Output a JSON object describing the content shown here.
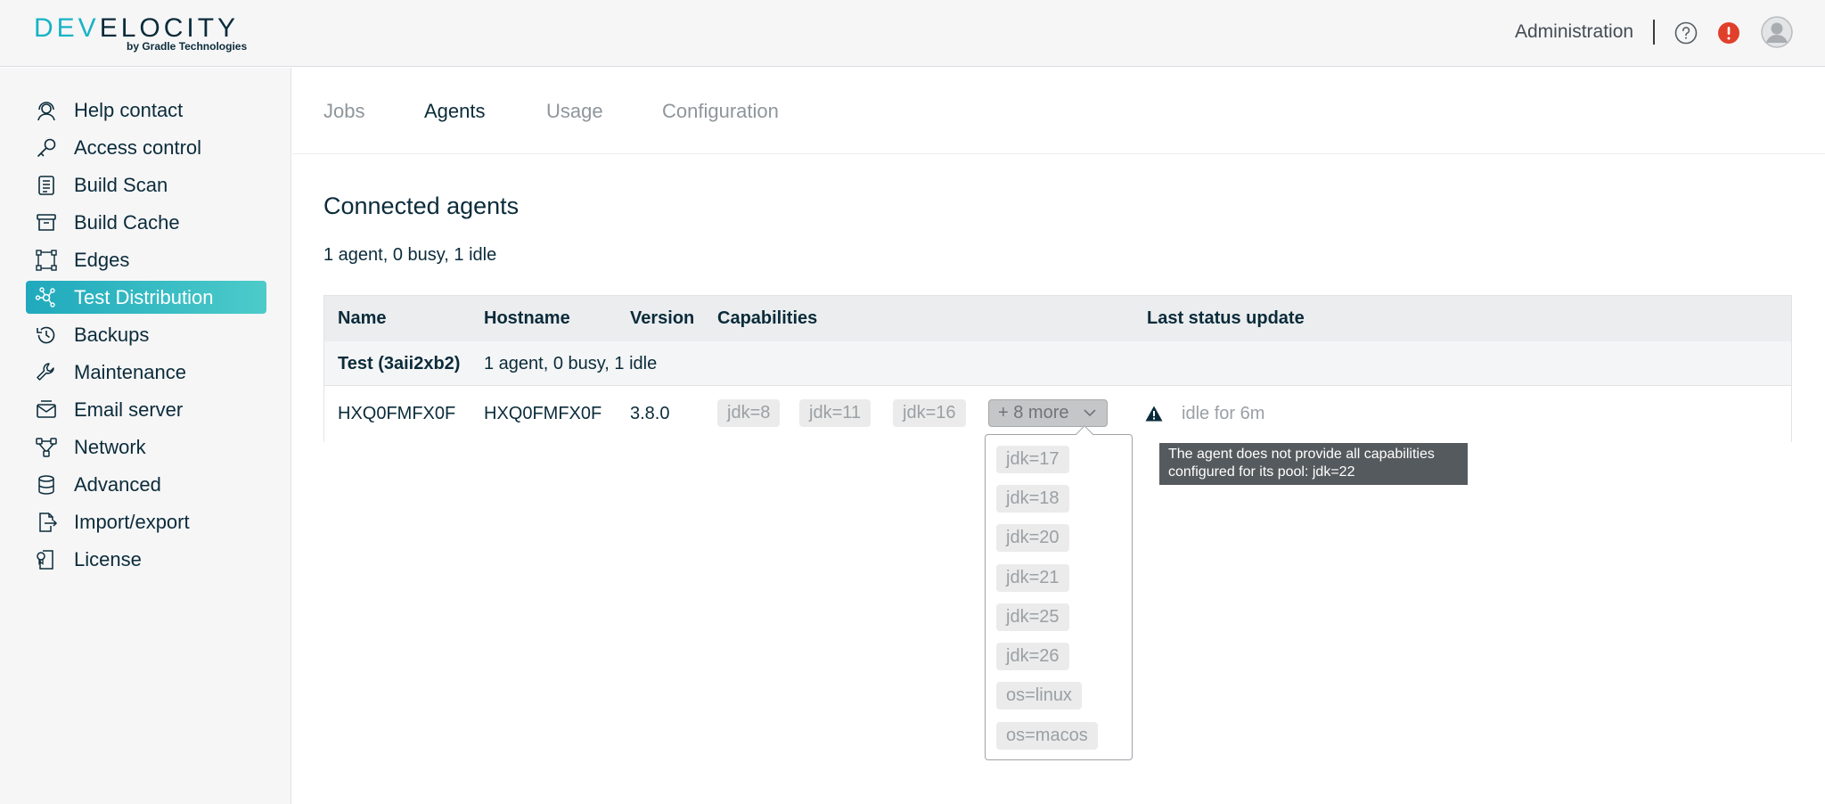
{
  "header": {
    "logo_text_colored": "DEV",
    "logo_text_rest": "ELOCITY",
    "logo_subtitle": "by Gradle Technologies",
    "admin_link": "Administration",
    "help_icon": "question-circle-icon",
    "alert_icon": "exclamation-circle-icon",
    "alert_color": "#e0402a",
    "avatar_icon": "user-avatar-icon"
  },
  "sidebar": {
    "accent_gradient": [
      "#20a9bd",
      "#4ccbc9"
    ],
    "items": [
      {
        "label": "Help contact",
        "icon": "headset-icon",
        "active": false
      },
      {
        "label": "Access control",
        "icon": "key-icon",
        "active": false
      },
      {
        "label": "Build Scan",
        "icon": "list-document-icon",
        "active": false
      },
      {
        "label": "Build Cache",
        "icon": "archive-box-icon",
        "active": false
      },
      {
        "label": "Edges",
        "icon": "edges-nodes-icon",
        "active": false
      },
      {
        "label": "Test Distribution",
        "icon": "distribution-network-icon",
        "active": true
      },
      {
        "label": "Backups",
        "icon": "history-icon",
        "active": false
      },
      {
        "label": "Maintenance",
        "icon": "wrench-icon",
        "active": false
      },
      {
        "label": "Email server",
        "icon": "email-server-icon",
        "active": false
      },
      {
        "label": "Network",
        "icon": "network-icon",
        "active": false
      },
      {
        "label": "Advanced",
        "icon": "database-icon",
        "active": false
      },
      {
        "label": "Import/export",
        "icon": "file-export-icon",
        "active": false
      },
      {
        "label": "License",
        "icon": "license-icon",
        "active": false
      }
    ]
  },
  "tabs": [
    {
      "label": "Jobs",
      "active": false
    },
    {
      "label": "Agents",
      "active": true
    },
    {
      "label": "Usage",
      "active": false
    },
    {
      "label": "Configuration",
      "active": false
    }
  ],
  "main": {
    "title": "Connected agents",
    "summary": "1 agent, 0 busy, 1 idle"
  },
  "table": {
    "columns": [
      "Name",
      "Hostname",
      "Version",
      "Capabilities",
      "Last status update"
    ],
    "group": {
      "name": "Test (3aii2xb2)",
      "summary": "1 agent, 0 busy, 1 idle"
    },
    "agent": {
      "name": "HXQ0FMFX0F",
      "hostname": "HXQ0FMFX0F",
      "version": "3.8.0",
      "capabilities": [
        "jdk=8",
        "jdk=11",
        "jdk=16"
      ],
      "more_label": "+ 8 more",
      "status_icon": "warning-triangle-icon",
      "status": "idle for 6m"
    }
  },
  "dropdown": {
    "items": [
      "jdk=17",
      "jdk=18",
      "jdk=20",
      "jdk=21",
      "jdk=25",
      "jdk=26",
      "os=linux",
      "os=macos"
    ]
  },
  "tooltip": {
    "line1": "The agent does not provide all capabilities",
    "line2": "configured for its pool: jdk=22"
  }
}
